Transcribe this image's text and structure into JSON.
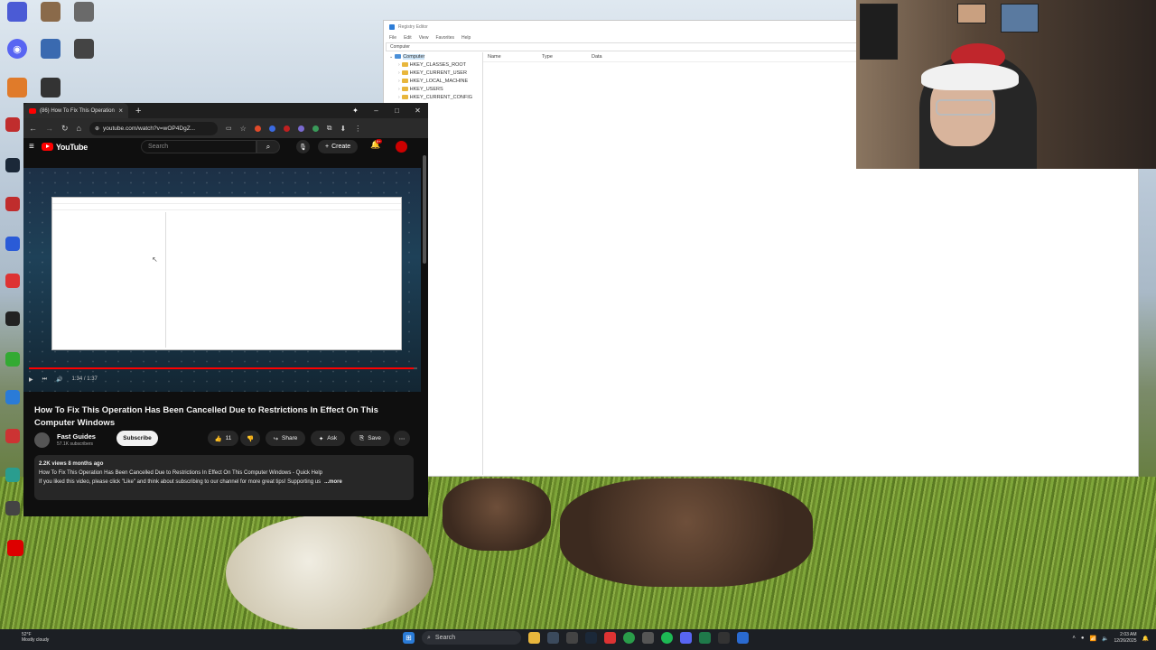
{
  "desktop": {
    "icons": [
      {
        "label": "",
        "color": "#4b5bd5"
      },
      {
        "label": "",
        "color": "#8a6a4a"
      },
      {
        "label": "",
        "color": "#6a6a6a"
      },
      {
        "label": "",
        "color": "#5865f2"
      },
      {
        "label": "",
        "color": "#3a6ab0"
      },
      {
        "label": "",
        "color": "#444"
      },
      {
        "label": "",
        "color": "#e07b2a"
      },
      {
        "label": "",
        "color": "#333"
      }
    ]
  },
  "registry": {
    "title": "Registry Editor",
    "menu": [
      "File",
      "Edit",
      "View",
      "Favorites",
      "Help"
    ],
    "address": "Computer",
    "tree": {
      "root": "Computer",
      "children": [
        "HKEY_CLASSES_ROOT",
        "HKEY_CURRENT_USER",
        "HKEY_LOCAL_MACHINE",
        "HKEY_USERS",
        "HKEY_CURRENT_CONFIG"
      ]
    },
    "columns": [
      "Name",
      "Type",
      "Data"
    ]
  },
  "browser": {
    "tab_title": "(86) How To Fix This Operation",
    "url": "youtube.com/watch?v=wOP4DgZ...",
    "youtube": {
      "logo_text": "YouTube",
      "search_placeholder": "Search",
      "create_label": "Create",
      "notification_badge": "9+"
    },
    "player": {
      "time": "1:34 / 1:37",
      "progress": 0.99
    },
    "video": {
      "title": "How To Fix This Operation Has Been Cancelled Due to Restrictions In Effect On This Computer Windows",
      "channel": "Fast Guides",
      "subscribers": "57.1K subscribers",
      "subscribe_label": "Subscribe",
      "likes": "11",
      "share_label": "Share",
      "ask_label": "Ask",
      "save_label": "Save",
      "views_date": "2.2K views  8 months ago",
      "desc_line1": "How To Fix This Operation Has Been Cancelled Due to Restrictions In Effect On This Computer Windows - Quick Help",
      "desc_line2": "If you liked this video, please click \"Like\" and think about subscribing to our channel for more great tips! Supporting us",
      "more_label": "...more"
    }
  },
  "taskbar": {
    "weather_temp": "52°F",
    "weather_desc": "Mostly cloudy",
    "search_label": "Search",
    "time": "2:03 AM",
    "date": "12/26/2025"
  }
}
